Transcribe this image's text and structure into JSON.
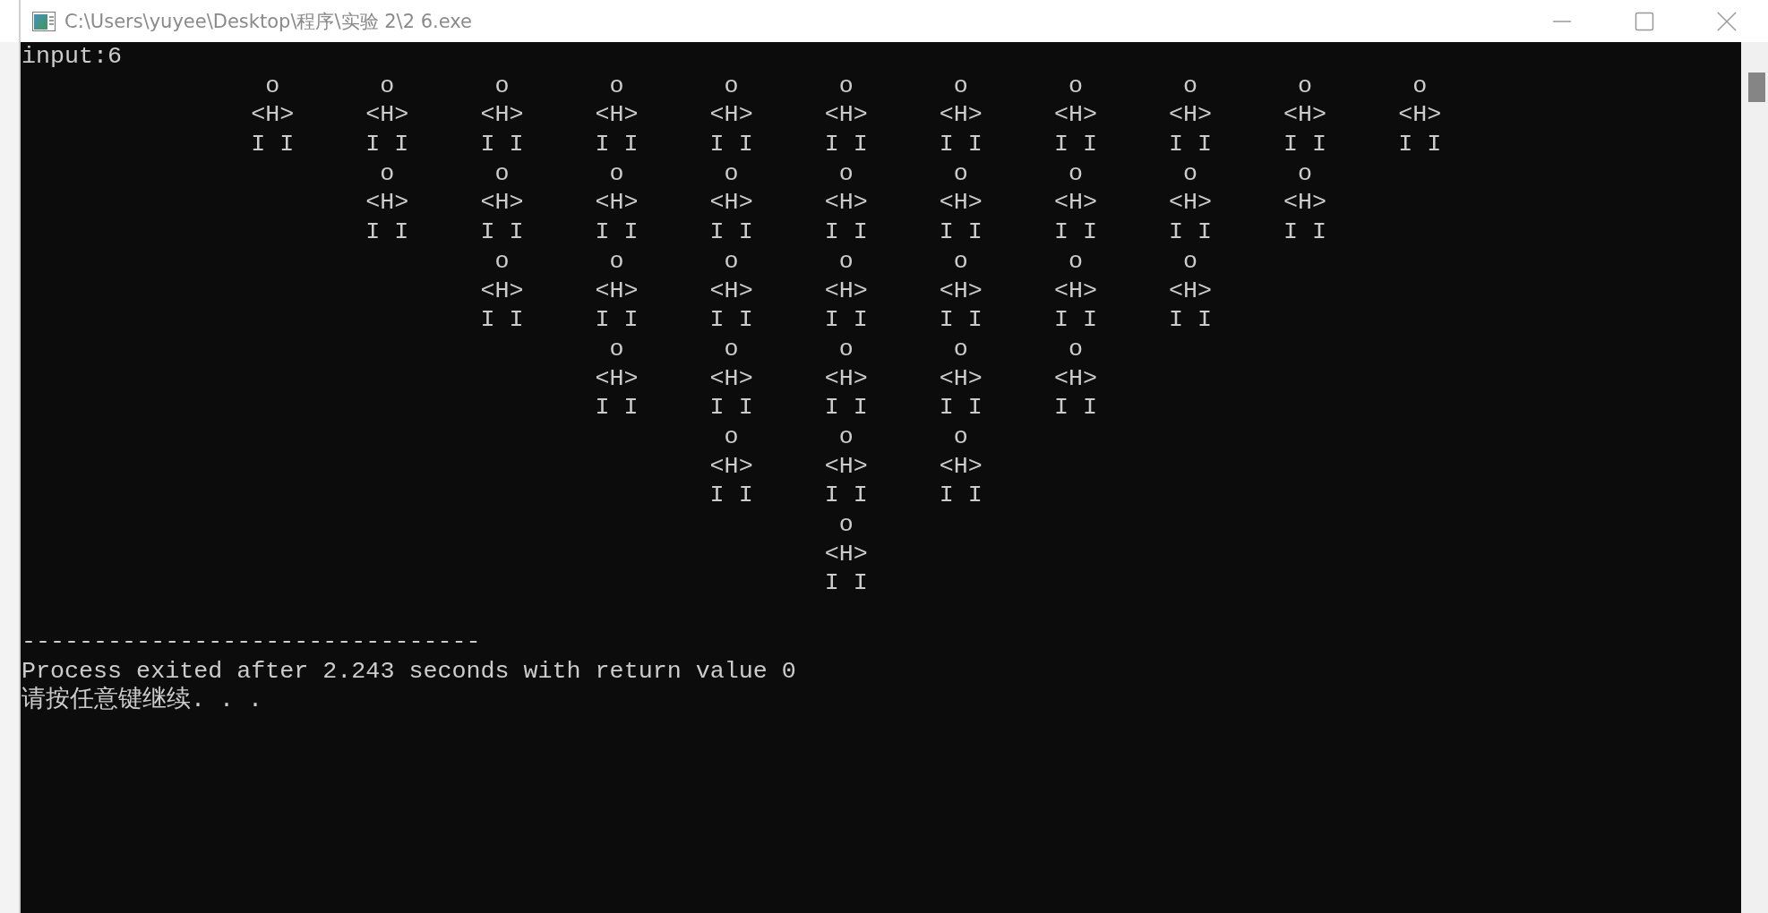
{
  "window": {
    "title": "C:\\Users\\yuyee\\Desktop\\程序\\实验 2\\2 6.exe"
  },
  "console": {
    "prompt_line": "input:6",
    "figure_columns": [
      {
        "figures": [
          {
            "head": "o",
            "body": "<H>",
            "legs": "I I"
          }
        ]
      },
      {
        "figures": [
          {
            "head": "o",
            "body": "<H>",
            "legs": "I I"
          },
          {
            "head": "o",
            "body": "<H>",
            "legs": "I I"
          }
        ]
      },
      {
        "figures": [
          {
            "head": "o",
            "body": "<H>",
            "legs": "I I"
          },
          {
            "head": "o",
            "body": "<H>",
            "legs": "I I"
          },
          {
            "head": "o",
            "body": "<H>",
            "legs": "I I"
          }
        ]
      },
      {
        "figures": [
          {
            "head": "o",
            "body": "<H>",
            "legs": "I I"
          },
          {
            "head": "o",
            "body": "<H>",
            "legs": "I I"
          },
          {
            "head": "o",
            "body": "<H>",
            "legs": "I I"
          },
          {
            "head": "o",
            "body": "<H>",
            "legs": "I I"
          }
        ]
      },
      {
        "figures": [
          {
            "head": "o",
            "body": "<H>",
            "legs": "I I"
          },
          {
            "head": "o",
            "body": "<H>",
            "legs": "I I"
          },
          {
            "head": "o",
            "body": "<H>",
            "legs": "I I"
          },
          {
            "head": "o",
            "body": "<H>",
            "legs": "I I"
          },
          {
            "head": "o",
            "body": "<H>",
            "legs": "I I"
          }
        ]
      },
      {
        "figures": [
          {
            "head": "o",
            "body": "<H>",
            "legs": "I I"
          },
          {
            "head": "o",
            "body": "<H>",
            "legs": "I I"
          },
          {
            "head": "o",
            "body": "<H>",
            "legs": "I I"
          },
          {
            "head": "o",
            "body": "<H>",
            "legs": "I I"
          },
          {
            "head": "o",
            "body": "<H>",
            "legs": "I I"
          },
          {
            "head": "o",
            "body": "<H>",
            "legs": "I I"
          }
        ]
      },
      {
        "figures": [
          {
            "head": "o",
            "body": "<H>",
            "legs": "I I"
          },
          {
            "head": "o",
            "body": "<H>",
            "legs": "I I"
          },
          {
            "head": "o",
            "body": "<H>",
            "legs": "I I"
          },
          {
            "head": "o",
            "body": "<H>",
            "legs": "I I"
          },
          {
            "head": "o",
            "body": "<H>",
            "legs": "I I"
          }
        ]
      },
      {
        "figures": [
          {
            "head": "o",
            "body": "<H>",
            "legs": "I I"
          },
          {
            "head": "o",
            "body": "<H>",
            "legs": "I I"
          },
          {
            "head": "o",
            "body": "<H>",
            "legs": "I I"
          },
          {
            "head": "o",
            "body": "<H>",
            "legs": "I I"
          }
        ]
      },
      {
        "figures": [
          {
            "head": "o",
            "body": "<H>",
            "legs": "I I"
          },
          {
            "head": "o",
            "body": "<H>",
            "legs": "I I"
          },
          {
            "head": "o",
            "body": "<H>",
            "legs": "I I"
          }
        ]
      },
      {
        "figures": [
          {
            "head": "o",
            "body": "<H>",
            "legs": "I I"
          },
          {
            "head": "o",
            "body": "<H>",
            "legs": "I I"
          }
        ]
      },
      {
        "figures": [
          {
            "head": "o",
            "body": "<H>",
            "legs": "I I"
          }
        ]
      }
    ],
    "separator": "--------------------------------",
    "exit_message": "Process exited after 2.243 seconds with return value 0",
    "continue_prompt": "请按任意键继续. . ."
  }
}
